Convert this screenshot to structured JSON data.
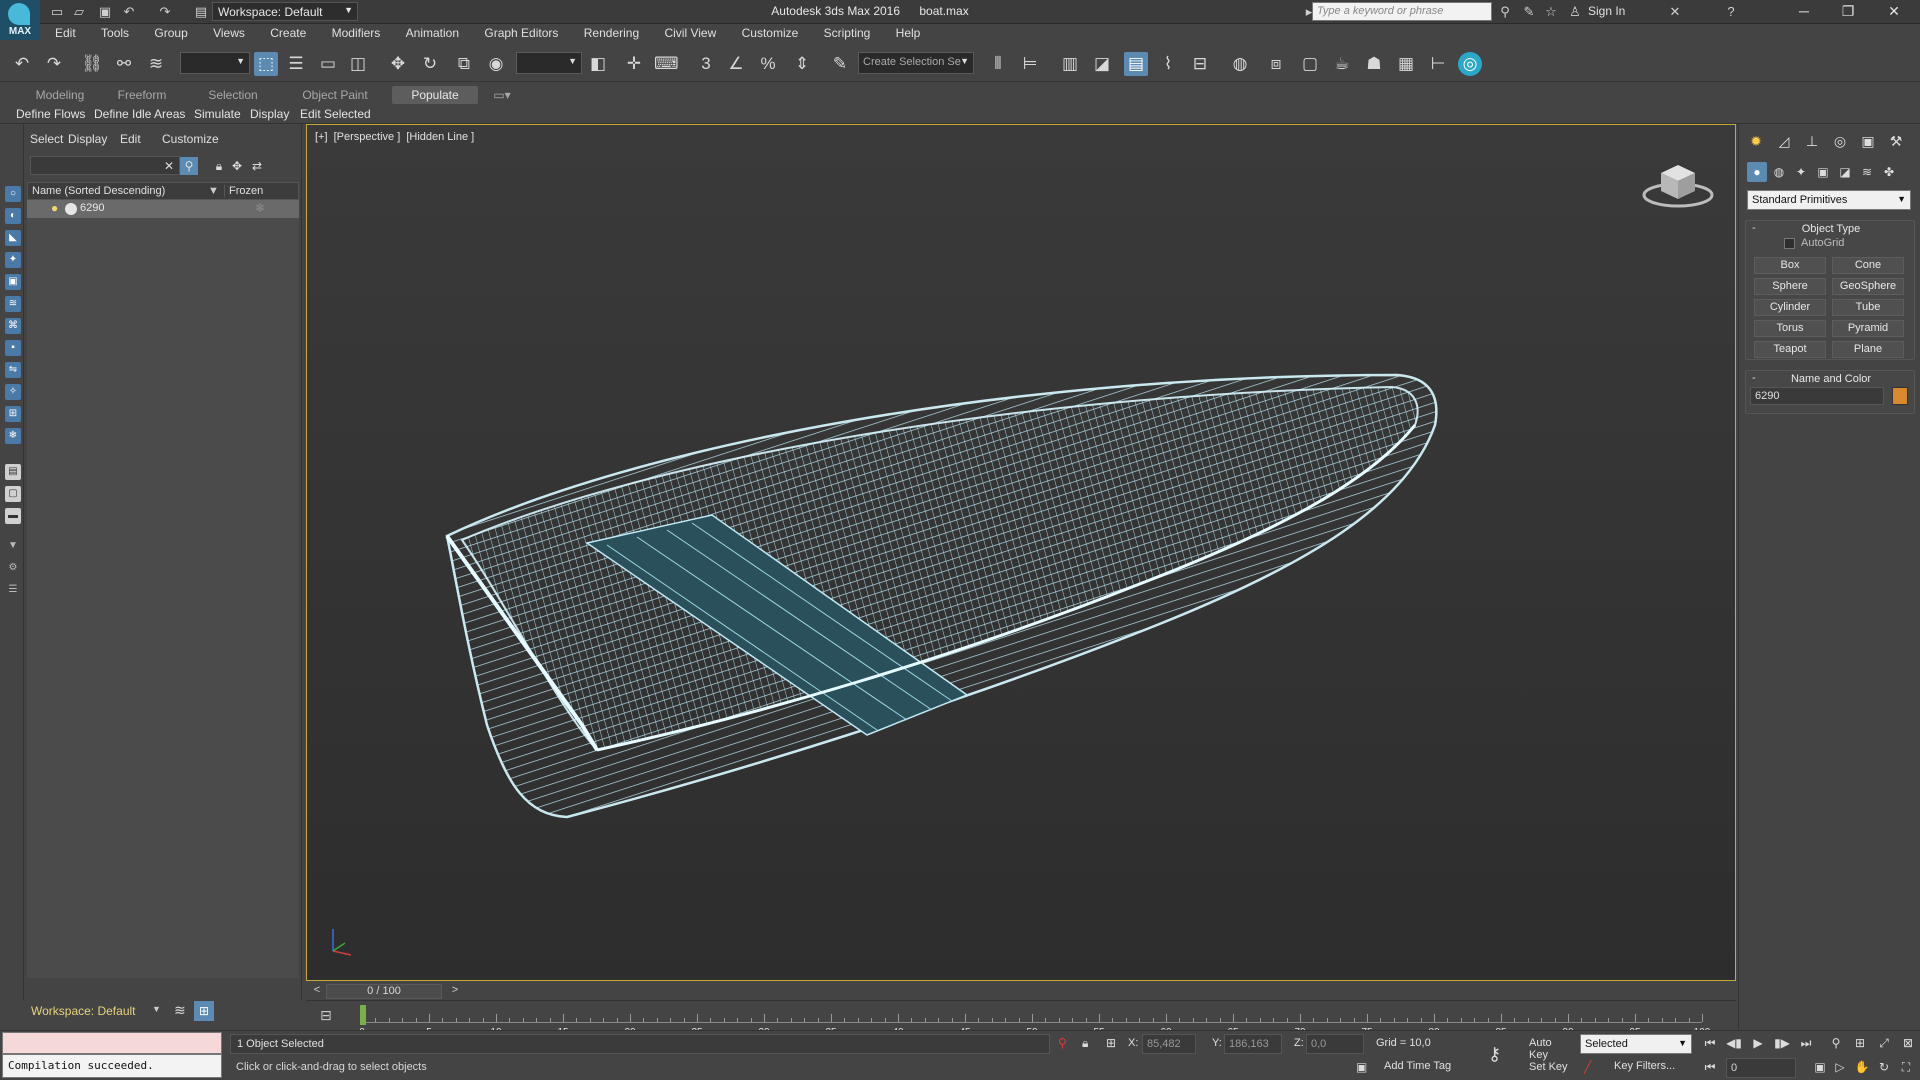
{
  "app": {
    "title": "Autodesk 3ds Max 2016",
    "file": "boat.max",
    "logo_text": "MAX",
    "workspace": "Workspace: Default",
    "search_placeholder": "Type a keyword or phrase",
    "sign_in": "Sign In"
  },
  "menu": [
    "Edit",
    "Tools",
    "Group",
    "Views",
    "Create",
    "Modifiers",
    "Animation",
    "Graph Editors",
    "Rendering",
    "Civil View",
    "Customize",
    "Scripting",
    "Help"
  ],
  "toolbar": {
    "named_selection_placeholder": "Create Selection Se",
    "snap_label": "3",
    "angle_snap_label": "%"
  },
  "ribbon": {
    "tabs": [
      "Modeling",
      "Freeform",
      "Selection",
      "Object Paint",
      "Populate"
    ],
    "active_tab": "Populate",
    "sub_items": [
      "Define Flows",
      "Define Idle Areas",
      "Simulate",
      "Display",
      "Edit Selected"
    ]
  },
  "scene_explorer": {
    "menu": [
      "Select",
      "Display",
      "Edit",
      "Customize"
    ],
    "columns": [
      "Name (Sorted Descending)",
      "Frozen"
    ],
    "rows": [
      {
        "name": "6290"
      }
    ],
    "footer_workspace": "Workspace: Default"
  },
  "viewport": {
    "labels": [
      "[+]",
      "[Perspective ]",
      "[Hidden Line ]"
    ],
    "wire_color": "#bfe9f5",
    "accent_border": "#c9a83a"
  },
  "time_slider": {
    "value": "0 / 100",
    "prev": "<",
    "next": ">"
  },
  "trackbar": {
    "ticks": [
      "0",
      "5",
      "10",
      "15",
      "20",
      "25",
      "30",
      "35",
      "40",
      "45",
      "50",
      "55",
      "60",
      "65",
      "70",
      "75",
      "80",
      "85",
      "90",
      "95",
      "100"
    ]
  },
  "status": {
    "maxscript_output": "Compilation succeeded.",
    "selected_text": "1 Object Selected",
    "prompt": "Click or click-and-drag to select objects",
    "x_label": "X:",
    "x_value": "85,482",
    "y_label": "Y:",
    "y_value": "186,163",
    "z_label": "Z:",
    "z_value": "0,0",
    "grid": "Grid = 10,0",
    "add_time_tag": "Add Time Tag",
    "auto_key": "Auto Key",
    "set_key": "Set Key",
    "key_mode": "Selected",
    "key_filters": "Key Filters...",
    "frame": "0"
  },
  "command_panel": {
    "dropdown": "Standard Primitives",
    "object_type_title": "Object Type",
    "collapse_symbol": "-",
    "autogrid": "AutoGrid",
    "primitives": [
      "Box",
      "Cone",
      "Sphere",
      "GeoSphere",
      "Cylinder",
      "Tube",
      "Torus",
      "Pyramid",
      "Teapot",
      "Plane"
    ],
    "name_color_title": "Name and Color",
    "object_name": "6290",
    "object_color": "#d88a2e"
  }
}
